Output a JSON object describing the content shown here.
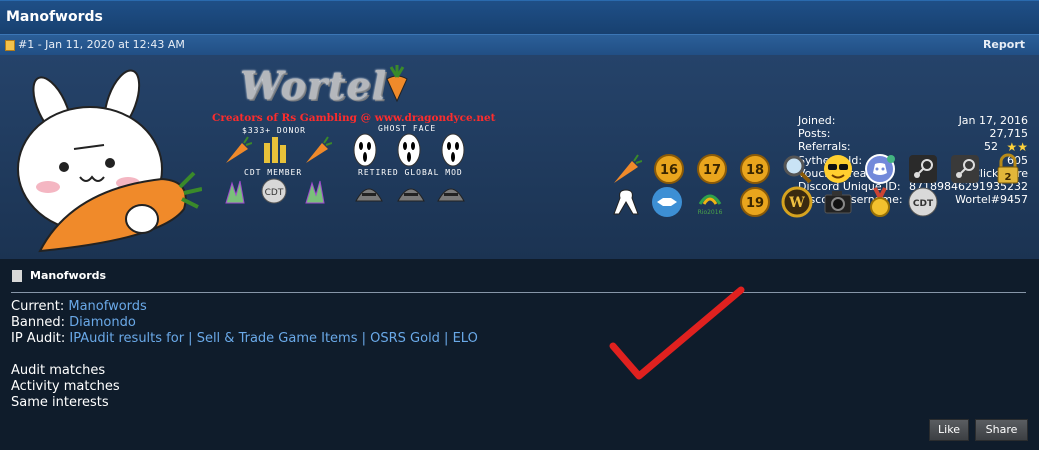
{
  "thread": {
    "title": "Manofwords"
  },
  "post": {
    "info": "#1 - Jan 11, 2020 at 12:43 AM",
    "report_label": "Report"
  },
  "signature": {
    "brand": "Wortel",
    "tagline": "Creators of Rs Gambling @ www.dragondyce.net",
    "group1_label": "$333+ DONOR",
    "group2_label": "GHOST FACE",
    "group3_label": "CDT MEMBER",
    "group4_label": "RETIRED GLOBAL MOD"
  },
  "stats": [
    {
      "label": "Joined:",
      "value": "Jan 17, 2016"
    },
    {
      "label": "Posts:",
      "value": "27,715"
    },
    {
      "label": "Referrals:",
      "value": "52"
    },
    {
      "label": "Sythe Gold:",
      "value": "605"
    },
    {
      "label": "Vouch Thread:",
      "value": "Click Here"
    },
    {
      "label": "Discord Unique ID:",
      "value": "871898462919352​32"
    },
    {
      "label": "Discord Username:",
      "value": "Wortel#9457"
    }
  ],
  "badges": {
    "row1": [
      "carrot-icon",
      "16-badge",
      "17-badge",
      "18-badge",
      "magnifier-icon",
      "sunglasses-emoji-icon",
      "discord-icon",
      "steam-icon",
      "steam-icon-2",
      "lock-2-icon"
    ],
    "row2": [
      "ribbon-icon",
      "handshake-icon",
      "rio2016-icon",
      "19-badge",
      "wow-icon",
      "camera-icon",
      "gold-medal-icon",
      "cdt-icon"
    ],
    "numbers": {
      "b16": "16",
      "b17": "17",
      "b18": "18",
      "b19": "19",
      "lock": "2"
    },
    "rio": "Rio2016",
    "cdt": "CDT"
  },
  "body": {
    "poster": "Manofwords",
    "current_label": "Current:",
    "current_value": "Manofwords",
    "banned_label": "Banned:",
    "banned_value": "Diamondo",
    "ip_label": "IP Audit:",
    "ip_value": "IPAudit results for | Sell & Trade Game Items | OSRS Gold | ELO",
    "audit": "Audit matches",
    "activity": "Activity matches",
    "interests": "Same interests"
  },
  "buttons": {
    "like": "Like",
    "share": "Share"
  },
  "colors": {
    "link": "#6aa9e8",
    "accent": "#1f4f87",
    "checkmark": "#e0211f"
  }
}
